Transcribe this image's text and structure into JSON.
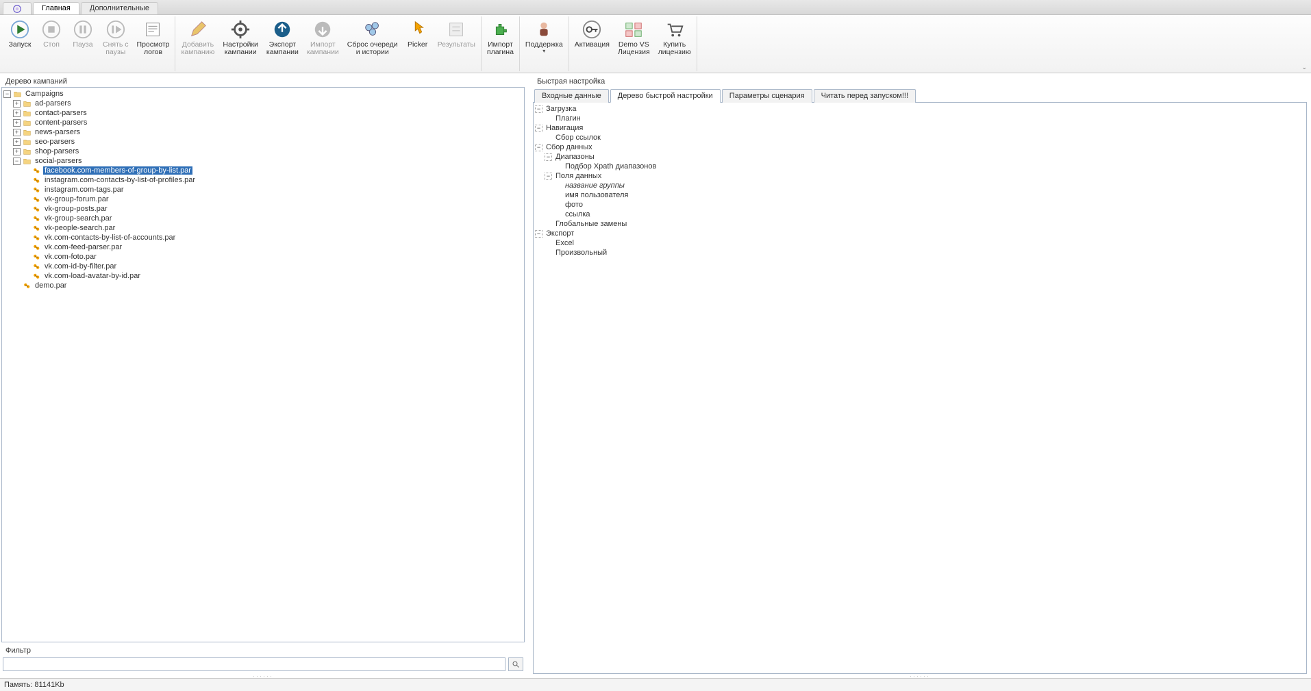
{
  "tabs": {
    "main": "Главная",
    "extra": "Дополнительные"
  },
  "ribbon": {
    "start": "Запуск",
    "stop": "Стоп",
    "pause": "Пауза",
    "unpause": "Снять с\nпаузы",
    "viewlogs": "Просмотр\nлогов",
    "addcamp": "Добавить\nкампанию",
    "settingscamp": "Настройки\nкампании",
    "exportcamp": "Экспорт\nкампании",
    "importcamp": "Импорт\nкампании",
    "reset": "Сброс очереди\nи истории",
    "picker": "Picker",
    "results": "Результаты",
    "importplugin": "Импорт\nплагина",
    "support": "Поддержка",
    "activation": "Активация",
    "demovs": "Demo VS\nЛицензия",
    "buy": "Купить\nлицензию"
  },
  "leftPanel": {
    "title": "Дерево кампаний",
    "filterTitle": "Фильтр"
  },
  "campaignsTree": {
    "root": "Campaigns",
    "folders": [
      "ad-parsers",
      "contact-parsers",
      "content-parsers",
      "news-parsers",
      "seo-parsers",
      "shop-parsers",
      "social-parsers"
    ],
    "socialFiles": [
      "facebook.com-members-of-group-by-list.par",
      "instagram.com-contacts-by-list-of-profiles.par",
      "instagram.com-tags.par",
      "vk-group-forum.par",
      "vk-group-posts.par",
      "vk-group-search.par",
      "vk-people-search.par",
      "vk.com-contacts-by-list-of-accounts.par",
      "vk.com-feed-parser.par",
      "vk.com-foto.par",
      "vk.com-id-by-filter.par",
      "vk.com-load-avatar-by-id.par"
    ],
    "demoFile": "demo.par",
    "selected": "facebook.com-members-of-group-by-list.par"
  },
  "rightPanel": {
    "title": "Быстрая настройка",
    "tabs": [
      "Входные данные",
      "Дерево быстрой настройки",
      "Параметры сценария",
      "Читать перед запуском!!!"
    ],
    "activeTab": 1
  },
  "quickTree": {
    "loading": "Загрузка",
    "plugin": "Плагин",
    "navigation": "Навигация",
    "collectLinks": "Сбор ссылок",
    "collectData": "Сбор данных",
    "ranges": "Диапазоны",
    "xpathRanges": "Подбор Xpath диапазонов",
    "dataFields": "Поля данных",
    "fields": [
      "название группы",
      "имя пользователя",
      "фото",
      "ссылка"
    ],
    "globalReplace": "Глобальные замены",
    "export": "Экспорт",
    "excel": "Excel",
    "custom": "Произвольный"
  },
  "status": {
    "memory": "Память: 81141Kb"
  }
}
